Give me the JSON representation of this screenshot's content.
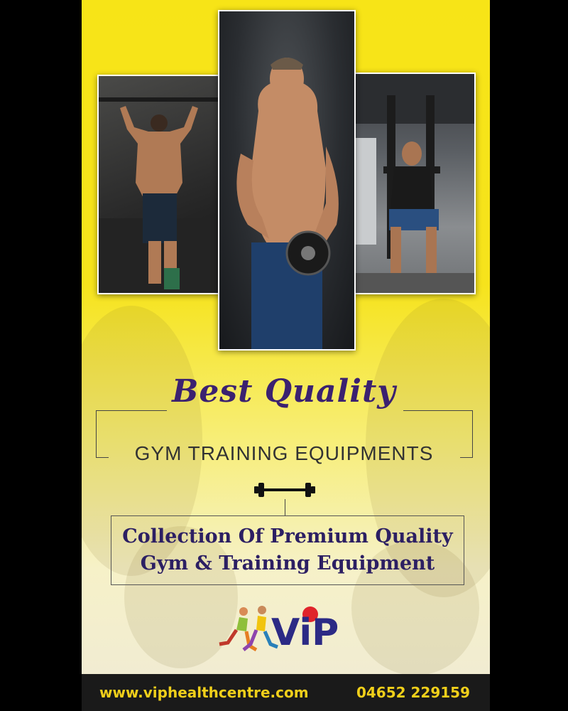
{
  "headline": {
    "script": "Best Quality",
    "subtitle": "GYM TRAINING EQUIPMENTS"
  },
  "description": {
    "line1": "Collection Of Premium Quality",
    "line2": "Gym & Training Equipment"
  },
  "logo": {
    "text": "ViP"
  },
  "footer": {
    "website": "www.viphealthcentre.com",
    "phone": "04652 229159"
  },
  "colors": {
    "background_yellow": "#f7e417",
    "title_purple": "#3b2170",
    "logo_blue": "#2c2a85",
    "logo_red": "#e0242b",
    "footer_text": "#f0cf1a"
  },
  "icons": [
    "dumbbell-icon",
    "runners-icon"
  ]
}
